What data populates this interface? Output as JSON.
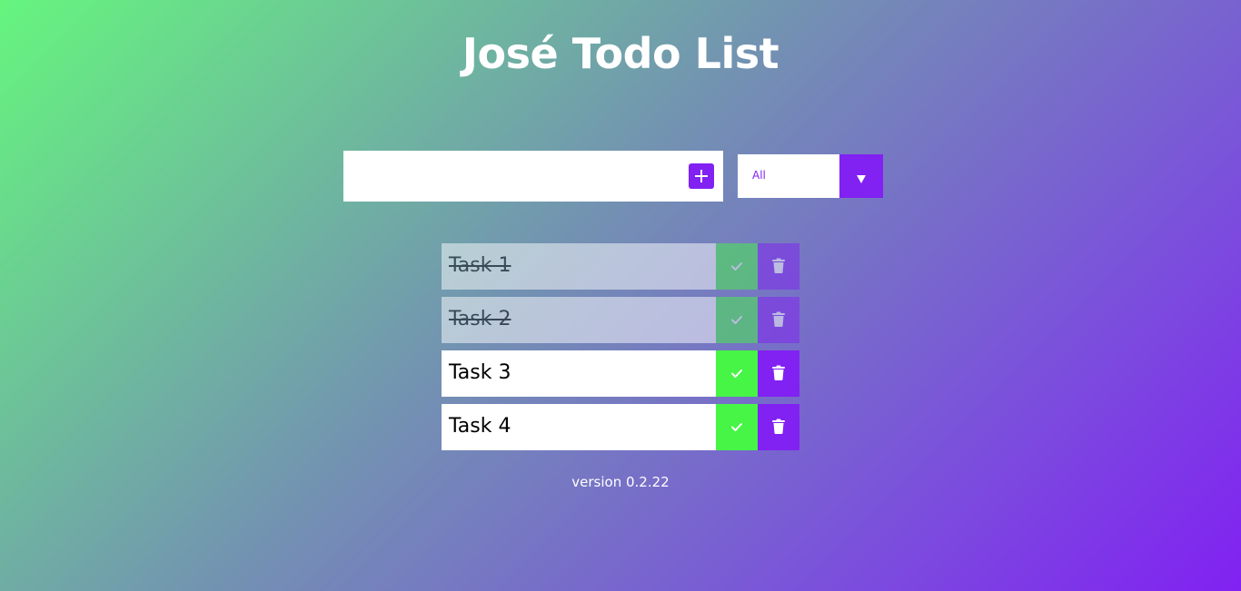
{
  "app": {
    "title": "José Todo List",
    "version": "version 0.2.22"
  },
  "form": {
    "input_value": "",
    "input_placeholder": "",
    "add_icon": "plus-icon",
    "filter": {
      "selected": "All",
      "arrow_icon": "caret-down-icon"
    }
  },
  "todos": [
    {
      "text": "Task 1",
      "completed": true
    },
    {
      "text": "Task 2",
      "completed": true
    },
    {
      "text": "Task 3",
      "completed": false
    },
    {
      "text": "Task 4",
      "completed": false
    }
  ],
  "colors": {
    "accent": "#8121f2",
    "complete": "#46f546",
    "gradient_start": "#66f57e",
    "gradient_end": "#8121f2"
  }
}
